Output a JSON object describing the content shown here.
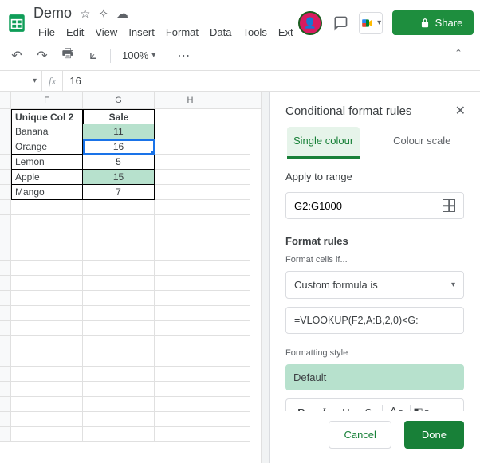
{
  "header": {
    "doc_title": "Demo",
    "menus": [
      "File",
      "Edit",
      "View",
      "Insert",
      "Format",
      "Data",
      "Tools",
      "Ext"
    ],
    "share_label": "Share"
  },
  "toolbar": {
    "zoom": "100%"
  },
  "formula_bar": {
    "name_box": "",
    "fx": "fx",
    "value": "16"
  },
  "grid": {
    "col_headers": [
      "F",
      "G",
      "H"
    ],
    "header_row": {
      "f": "Unique Col 2",
      "g": "Sale"
    },
    "rows": [
      {
        "f": "Banana",
        "g": "11",
        "hl": true
      },
      {
        "f": "Orange",
        "g": "16",
        "hl": false,
        "active": true
      },
      {
        "f": "Lemon",
        "g": "5",
        "hl": false
      },
      {
        "f": "Apple",
        "g": "15",
        "hl": true
      },
      {
        "f": "Mango",
        "g": "7",
        "hl": false
      }
    ]
  },
  "sidepanel": {
    "title": "Conditional format rules",
    "tabs": {
      "single": "Single colour",
      "scale": "Colour scale"
    },
    "apply_label": "Apply to range",
    "range_value": "G2:G1000",
    "rules_title": "Format rules",
    "cells_if_label": "Format cells if...",
    "condition": "Custom formula is",
    "formula": "=VLOOKUP(F2,A:B,2,0)<G:",
    "style_label": "Formatting style",
    "style_preview": "Default",
    "fmt_buttons": {
      "b": "B",
      "i": "I",
      "u": "U",
      "s": "S",
      "a": "A"
    },
    "cancel": "Cancel",
    "done": "Done"
  }
}
